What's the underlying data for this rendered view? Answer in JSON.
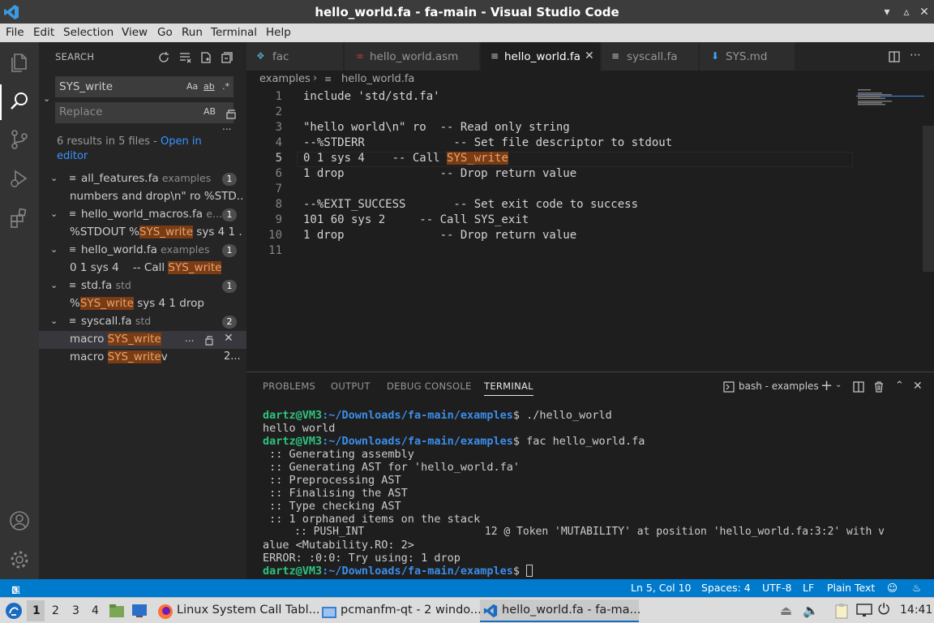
{
  "window": {
    "title": "hello_world.fa - fa-main - Visual Studio Code"
  },
  "menu": [
    "File",
    "Edit",
    "Selection",
    "View",
    "Go",
    "Run",
    "Terminal",
    "Help"
  ],
  "sidebar": {
    "title": "SEARCH",
    "search_value": "SYS_write",
    "search_opts": {
      "case": "Aa",
      "word": "ab",
      "regex": ".*"
    },
    "replace_placeholder": "Replace",
    "replace_opt": "AB",
    "more": "...",
    "summary": "6 results in 5 files - ",
    "open_link": "Open in editor",
    "files": [
      {
        "name": "all_features.fa",
        "dir": "examples",
        "count": "1",
        "matches": [
          {
            "pre": "numbers and drop\\n\" ro %STD...",
            "hit": "",
            "post": ""
          }
        ]
      },
      {
        "name": "hello_world_macros.fa",
        "dir": "e...",
        "count": "1",
        "matches": [
          {
            "pre": "%STDOUT %",
            "hit": "SYS_write",
            "post": " sys 4 1 ..."
          }
        ]
      },
      {
        "name": "hello_world.fa",
        "dir": "examples",
        "count": "1",
        "matches": [
          {
            "pre": "0 1 sys 4    -- Call ",
            "hit": "SYS_write",
            "post": ""
          }
        ]
      },
      {
        "name": "std.fa",
        "dir": "std",
        "count": "1",
        "matches": [
          {
            "pre": "%",
            "hit": "SYS_write",
            "post": " sys 4 1 drop"
          }
        ]
      },
      {
        "name": "syscall.fa",
        "dir": "std",
        "count": "2",
        "matches": [
          {
            "pre": "macro ",
            "hit": "SYS_write",
            "post": ""
          },
          {
            "pre": "macro ",
            "hit": "SYS_write",
            "post": "v"
          }
        ]
      }
    ],
    "row_actions": "...",
    "second_match_suffix": "2..."
  },
  "tabs": [
    {
      "label": "fac",
      "active": false
    },
    {
      "label": "hello_world.asm",
      "active": false
    },
    {
      "label": "hello_world.fa",
      "active": true
    },
    {
      "label": "syscall.fa",
      "active": false
    },
    {
      "label": "SYS.md",
      "active": false
    }
  ],
  "breadcrumb": {
    "folder": "examples",
    "file": "hello_world.fa"
  },
  "editor": {
    "line_numbers": [
      "1",
      "2",
      "3",
      "4",
      "5",
      "6",
      "7",
      "8",
      "9",
      "10",
      "11"
    ],
    "lines": [
      "include 'std/std.fa'",
      "",
      "\"hello world\\n\" ro  -- Read only string",
      "--%STDERR             -- Set file descriptor to stdout",
      "0 1 sys 4    -- Call SYS_write",
      "1 drop              -- Drop return value",
      "",
      "--%EXIT_SUCCESS       -- Set exit code to success",
      "101 60 sys 2     -- Call SYS_exit",
      "1 drop              -- Drop return value",
      ""
    ],
    "line5_pre": "0 1 sys 4    -- Call ",
    "line5_hit": "SYS_write"
  },
  "panel": {
    "tabs": [
      "PROBLEMS",
      "OUTPUT",
      "DEBUG CONSOLE",
      "TERMINAL"
    ],
    "terminal_selector": "bash - examples",
    "prompt_user": "dartz@VM3",
    "prompt_path": ":~/Downloads/fa-main/examples",
    "terminal": [
      {
        "type": "prompt",
        "cmd": "$ ./hello_world"
      },
      {
        "type": "out",
        "text": "hello world"
      },
      {
        "type": "prompt",
        "cmd": "$ fac hello_world.fa"
      },
      {
        "type": "out",
        "text": " :: Generating assembly"
      },
      {
        "type": "out",
        "text": " :: Generating AST for 'hello_world.fa'"
      },
      {
        "type": "out",
        "text": " :: Preprocessing AST"
      },
      {
        "type": "out",
        "text": " :: Finalising the AST"
      },
      {
        "type": "out",
        "text": " :: Type checking AST"
      },
      {
        "type": "out",
        "text": " :: 1 orphaned items on the stack"
      },
      {
        "type": "out",
        "text": "     :: PUSH_INT                   12 @ Token 'MUTABILITY' at position 'hello_world.fa:3:2' with v"
      },
      {
        "type": "out",
        "text": "alue <Mutability.RO: 2>"
      },
      {
        "type": "out",
        "text": "ERROR: :0:0: Try using: 1 drop"
      },
      {
        "type": "prompt",
        "cmd": "$ "
      }
    ]
  },
  "statusbar": {
    "errors": "0",
    "warnings": "0",
    "position": "Ln 5, Col 10",
    "spaces": "Spaces: 4",
    "encoding": "UTF-8",
    "eol": "LF",
    "language": "Plain Text"
  },
  "taskbar": {
    "workspaces": [
      "1",
      "2",
      "3",
      "4"
    ],
    "windows": [
      {
        "label": "Linux System Call Tabl..."
      },
      {
        "label": "pcmanfm-qt - 2 windo..."
      },
      {
        "label": "hello_world.fa - fa-ma..."
      }
    ],
    "clock": "14:41"
  },
  "colors": {
    "accent": "#007acc",
    "match_highlight": "#7a3c14"
  }
}
